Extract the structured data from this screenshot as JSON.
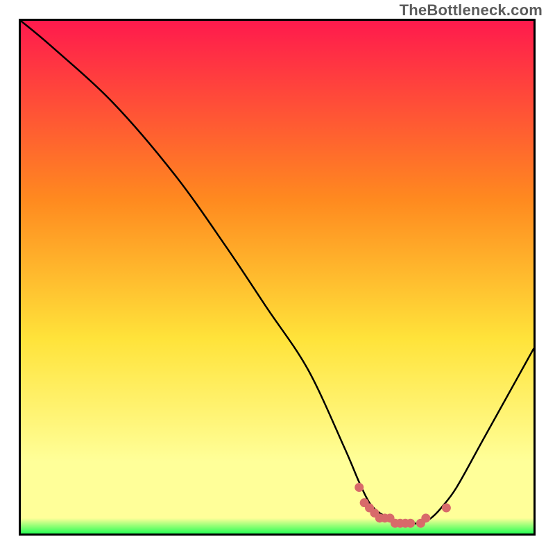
{
  "watermark": "TheBottleneck.com",
  "colors": {
    "gradient_top": "#ff1a4d",
    "gradient_mid1": "#ff8a1f",
    "gradient_mid2": "#ffe33a",
    "gradient_bottom_yellow": "#ffff99",
    "gradient_bottom_green": "#2aff55",
    "line_stroke": "#000000",
    "marker_fill": "#d86a6a"
  },
  "chart_data": {
    "type": "line",
    "title": "",
    "xlabel": "",
    "ylabel": "",
    "xlim": [
      0,
      100
    ],
    "ylim": [
      0,
      100
    ],
    "note": "Axis ticks and numeric labels are not shown in the image; values below are estimated percentages of the plotting area (0 = left/bottom, 100 = right/top).",
    "series": [
      {
        "name": "bottleneck-curve",
        "x": [
          0,
          6,
          18,
          30,
          40,
          48,
          56,
          63,
          66,
          68,
          70,
          72,
          74,
          76,
          78,
          80,
          82,
          85,
          90,
          95,
          100
        ],
        "y": [
          100,
          95,
          84,
          70,
          56,
          44,
          32,
          17,
          10,
          6,
          4,
          3,
          2,
          2,
          2,
          3,
          5,
          9,
          18,
          27,
          36
        ]
      }
    ],
    "markers": [
      {
        "x": 66,
        "y": 9
      },
      {
        "x": 67,
        "y": 6
      },
      {
        "x": 68,
        "y": 5
      },
      {
        "x": 69,
        "y": 4
      },
      {
        "x": 70,
        "y": 3
      },
      {
        "x": 71,
        "y": 3
      },
      {
        "x": 72,
        "y": 3
      },
      {
        "x": 73,
        "y": 2
      },
      {
        "x": 74,
        "y": 2
      },
      {
        "x": 75,
        "y": 2
      },
      {
        "x": 76,
        "y": 2
      },
      {
        "x": 78,
        "y": 2
      },
      {
        "x": 79,
        "y": 3
      },
      {
        "x": 83,
        "y": 5
      }
    ]
  }
}
